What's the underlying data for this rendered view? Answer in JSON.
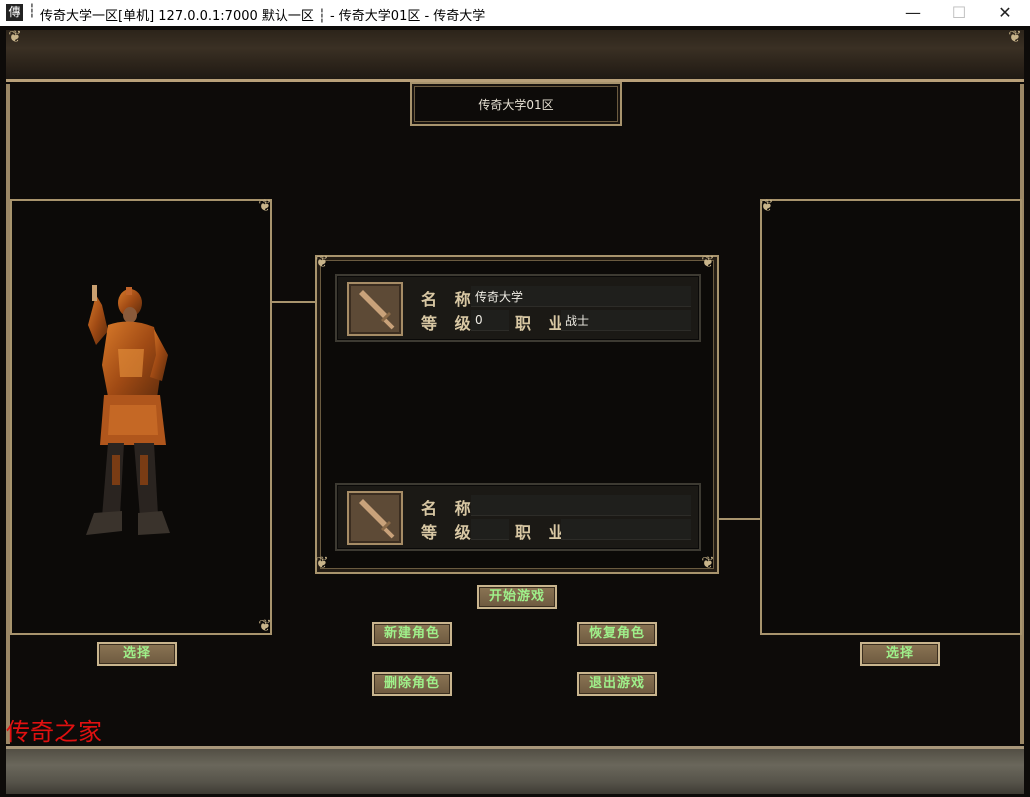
{
  "window": {
    "app_icon_glyph": "傳",
    "title": "传奇大学一区[单机] 127.0.0.1:7000  默认一区 ┆ - 传奇大学01区 - 传奇大学",
    "separator": "┆",
    "minimize": "—",
    "maximize": "☐",
    "close": "✕"
  },
  "server": {
    "name": "传奇大学01区"
  },
  "characters": [
    {
      "name_label": "名 称",
      "level_label": "等 级",
      "job_label": "职 业",
      "name": "传奇大学",
      "level": "0",
      "job": "战士"
    },
    {
      "name_label": "名 称",
      "level_label": "等 级",
      "job_label": "职 业",
      "name": "",
      "level": "",
      "job": ""
    }
  ],
  "buttons": {
    "select_left": "选择",
    "select_right": "选择",
    "start_game": "开始游戏",
    "new_character": "新建角色",
    "restore_character": "恢复角色",
    "delete_character": "删除角色",
    "exit_game": "退出游戏"
  },
  "watermark": "传奇之家",
  "colors": {
    "frame_gold": "#a8946d",
    "button_text_green": "#8fe07a",
    "watermark_red": "#e01010"
  },
  "icons": {
    "character_slot": "sword-icon"
  }
}
